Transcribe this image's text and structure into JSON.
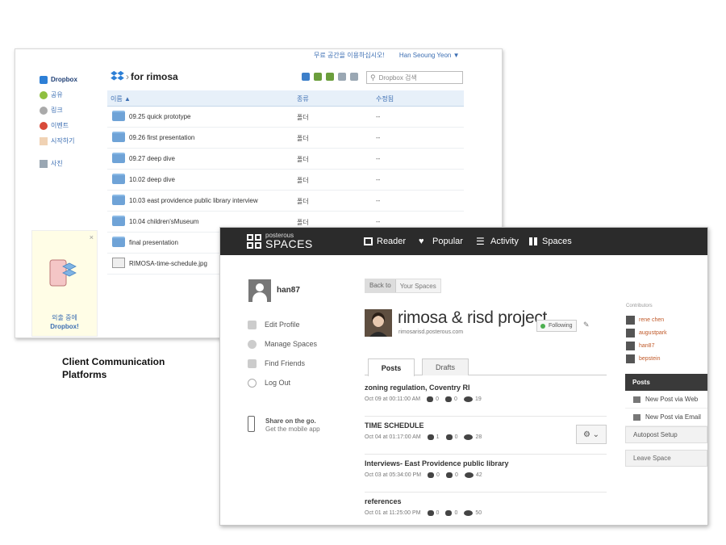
{
  "caption": {
    "line1": "Client Communication",
    "line2": "Platforms"
  },
  "dropbox": {
    "promo": "무료 공간을 이용하십시오!",
    "user": "Han Seoung Yeon ▼",
    "sidebar": [
      {
        "label": "Dropbox",
        "icon": "dropbox-icon"
      },
      {
        "label": "공유",
        "icon": "share-icon"
      },
      {
        "label": "링크",
        "icon": "link-icon"
      },
      {
        "label": "이벤트",
        "icon": "events-icon"
      },
      {
        "label": "시작하기",
        "icon": "get-started-icon"
      },
      {
        "label": "사진",
        "icon": "photos-icon"
      }
    ],
    "breadcrumb": "for rimosa",
    "search_placeholder": "Dropbox 검색",
    "columns": {
      "name": "이름 ▲",
      "kind": "종류",
      "modified": "수정됨"
    },
    "files": [
      {
        "name": "09.25 quick prototype",
        "kind": "폴더",
        "modified": "--",
        "type": "folder"
      },
      {
        "name": "09.26 first presentation",
        "kind": "폴더",
        "modified": "--",
        "type": "folder"
      },
      {
        "name": "09.27 deep dive",
        "kind": "폴더",
        "modified": "--",
        "type": "folder"
      },
      {
        "name": "10.02 deep dive",
        "kind": "폴더",
        "modified": "--",
        "type": "folder"
      },
      {
        "name": "10.03 east providence public library interview",
        "kind": "폴더",
        "modified": "--",
        "type": "folder"
      },
      {
        "name": "10.04 children'sMuseum",
        "kind": "폴더",
        "modified": "--",
        "type": "folder"
      },
      {
        "name": "final presentation",
        "kind": "",
        "modified": "",
        "type": "folder"
      },
      {
        "name": "RIMOSA-time-schedule.jpg",
        "kind": "",
        "modified": "",
        "type": "image"
      }
    ],
    "ad": {
      "close": "×",
      "line1": "외출 중에",
      "line2": "Dropbox!"
    }
  },
  "posterous": {
    "brand_small": "posterous",
    "brand_big": "SPACES",
    "nav": [
      {
        "label": "Reader",
        "icon": "reader-icon"
      },
      {
        "label": "Popular",
        "icon": "heart-icon"
      },
      {
        "label": "Activity",
        "icon": "list-icon"
      },
      {
        "label": "Spaces",
        "icon": "grid-icon"
      }
    ],
    "username": "han87",
    "menu": [
      "Edit Profile",
      "Manage Spaces",
      "Find Friends",
      "Log Out"
    ],
    "mobile": {
      "line1": "Share on the go.",
      "line2": "Get the mobile app"
    },
    "back": {
      "back_label": "Back to",
      "target": "Your Spaces"
    },
    "space_title": "rimosa & risd project",
    "space_url": "rimosarisd.posterous.com",
    "following": "Following",
    "tabs": [
      "Posts",
      "Drafts"
    ],
    "posts": [
      {
        "title": "zoning regulation, Coventry RI",
        "date": "Oct 09 at 00:11:00 AM",
        "comments": "0",
        "likes": "0",
        "views": "19"
      },
      {
        "title": "TIME SCHEDULE",
        "date": "Oct 04 at 01:17:00 AM",
        "comments": "1",
        "likes": "0",
        "views": "28"
      },
      {
        "title": "Interviews- East Providence public library",
        "date": "Oct 03 at 05:34:00 PM",
        "comments": "0",
        "likes": "0",
        "views": "42"
      },
      {
        "title": "references",
        "date": "Oct 01 at 11:25:00 PM",
        "comments": "0",
        "likes": "0",
        "views": "50"
      }
    ],
    "gear": "⚙ ⌄",
    "contributors_label": "Contributors",
    "contributors": [
      "rene chen",
      "augustpark",
      "han87",
      "bepstein"
    ],
    "panel": {
      "head": "Posts",
      "items": [
        "New Post via Web",
        "New Post via Email"
      ],
      "autopost": "Autopost Setup",
      "leave": "Leave Space"
    }
  }
}
